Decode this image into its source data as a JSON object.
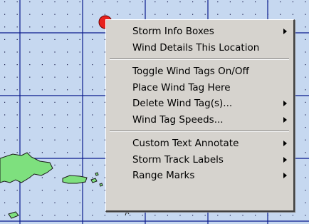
{
  "map": {
    "background_color": "#c6d8f0",
    "grid_color": "#0a1a8c",
    "dot_color": "#1a1a4a",
    "land_color": "#7ee07e",
    "storm_marker_color": "#e8211c"
  },
  "context_menu": {
    "background_color": "#d6d3ce",
    "groups": [
      [
        {
          "label": "Storm Info Boxes",
          "submenu": true
        },
        {
          "label": "Wind Details This Location",
          "submenu": false
        }
      ],
      [
        {
          "label": "Toggle Wind Tags On/Off",
          "submenu": false
        },
        {
          "label": "Place Wind Tag Here",
          "submenu": false
        },
        {
          "label": "Delete Wind Tag(s)...",
          "submenu": true
        },
        {
          "label": "Wind Tag Speeds...",
          "submenu": true
        }
      ],
      [
        {
          "label": "Custom Text Annotate",
          "submenu": true
        },
        {
          "label": "Storm Track Labels",
          "submenu": true
        },
        {
          "label": "Range Marks",
          "submenu": true
        }
      ]
    ]
  }
}
